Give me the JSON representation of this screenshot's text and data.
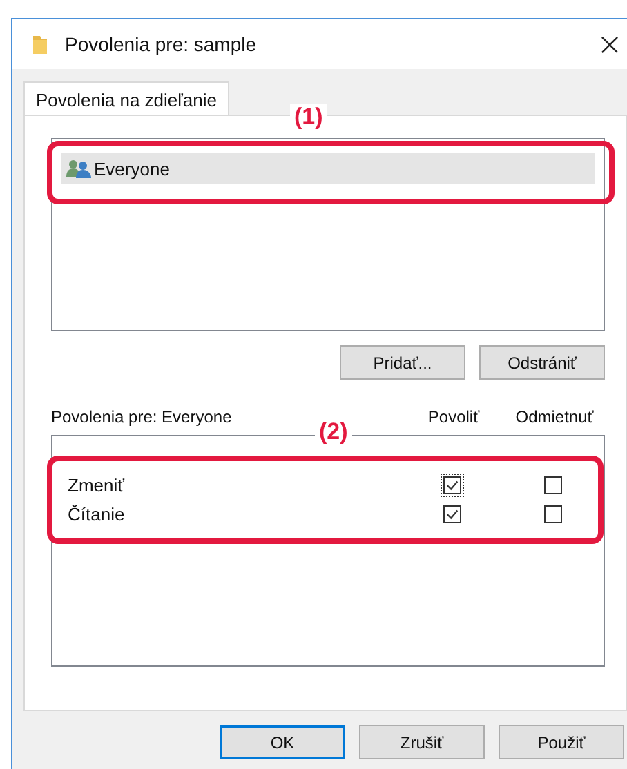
{
  "window": {
    "title": "Povolenia pre: sample"
  },
  "tabs": [
    {
      "label": "Povolenia na zdieľanie",
      "selected": true
    }
  ],
  "users": {
    "callout": "(1)",
    "items": [
      {
        "name": "Everyone",
        "selected": true
      }
    ]
  },
  "user_buttons": [
    "Pridať...",
    "Odstrániť"
  ],
  "permissions": {
    "label": "Povolenia pre: Everyone",
    "callout": "(2)",
    "columns": [
      "Povoliť",
      "Odmietnuť"
    ],
    "rows": [
      {
        "name": "Zmeniť",
        "allow": true,
        "deny": false,
        "focused": true
      },
      {
        "name": "Čítanie",
        "allow": true,
        "deny": false,
        "focused": false
      }
    ]
  },
  "buttons": [
    {
      "label": "OK",
      "default": true
    },
    {
      "label": "Zrušiť",
      "default": false
    },
    {
      "label": "Použiť",
      "default": false
    }
  ]
}
